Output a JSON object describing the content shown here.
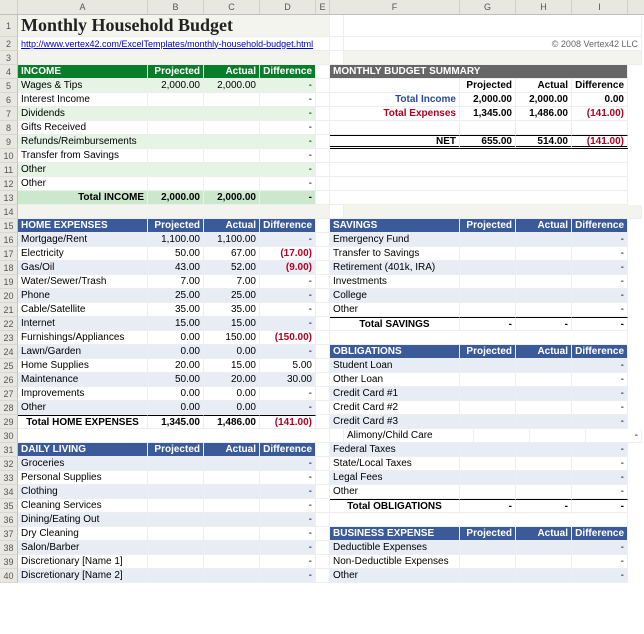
{
  "title": "Monthly Household Budget",
  "link": "http://www.vertex42.com/ExcelTemplates/monthly-household-budget.html",
  "copyright": "© 2008 Vertex42 LLC",
  "cols": [
    "",
    "A",
    "B",
    "C",
    "D",
    "E",
    "F",
    "G",
    "H",
    "I"
  ],
  "cols_w": [
    18,
    130,
    56,
    56,
    56,
    14,
    130,
    56,
    56,
    56
  ],
  "headers": {
    "proj": "Projected",
    "act": "Actual",
    "diff": "Difference"
  },
  "income": {
    "title": "INCOME",
    "rows": [
      {
        "n": "Wages & Tips",
        "p": "2,000.00",
        "a": "2,000.00",
        "d": "-"
      },
      {
        "n": "Interest Income",
        "p": "",
        "a": "",
        "d": "-"
      },
      {
        "n": "Dividends",
        "p": "",
        "a": "",
        "d": "-"
      },
      {
        "n": "Gifts Received",
        "p": "",
        "a": "",
        "d": "-"
      },
      {
        "n": "Refunds/Reimbursements",
        "p": "",
        "a": "",
        "d": "-"
      },
      {
        "n": "Transfer from Savings",
        "p": "",
        "a": "",
        "d": "-"
      },
      {
        "n": "Other",
        "p": "",
        "a": "",
        "d": "-"
      },
      {
        "n": "Other",
        "p": "",
        "a": "",
        "d": "-"
      }
    ],
    "total": {
      "n": "Total INCOME",
      "p": "2,000.00",
      "a": "2,000.00",
      "d": "-"
    }
  },
  "summary": {
    "title": "MONTHLY BUDGET SUMMARY",
    "income": {
      "n": "Total Income",
      "p": "2,000.00",
      "a": "2,000.00",
      "d": "0.00"
    },
    "expenses": {
      "n": "Total Expenses",
      "p": "1,345.00",
      "a": "1,486.00",
      "d": "(141.00)"
    },
    "net": {
      "n": "NET",
      "p": "655.00",
      "a": "514.00",
      "d": "(141.00)"
    }
  },
  "home": {
    "title": "HOME EXPENSES",
    "rows": [
      {
        "n": "Mortgage/Rent",
        "p": "1,100.00",
        "a": "1,100.00",
        "d": "-"
      },
      {
        "n": "Electricity",
        "p": "50.00",
        "a": "67.00",
        "d": "(17.00)"
      },
      {
        "n": "Gas/Oil",
        "p": "43.00",
        "a": "52.00",
        "d": "(9.00)"
      },
      {
        "n": "Water/Sewer/Trash",
        "p": "7.00",
        "a": "7.00",
        "d": "-"
      },
      {
        "n": "Phone",
        "p": "25.00",
        "a": "25.00",
        "d": "-"
      },
      {
        "n": "Cable/Satellite",
        "p": "35.00",
        "a": "35.00",
        "d": "-"
      },
      {
        "n": "Internet",
        "p": "15.00",
        "a": "15.00",
        "d": "-"
      },
      {
        "n": "Furnishings/Appliances",
        "p": "0.00",
        "a": "150.00",
        "d": "(150.00)"
      },
      {
        "n": "Lawn/Garden",
        "p": "0.00",
        "a": "0.00",
        "d": "-"
      },
      {
        "n": "Home Supplies",
        "p": "20.00",
        "a": "15.00",
        "d": "5.00"
      },
      {
        "n": "Maintenance",
        "p": "50.00",
        "a": "20.00",
        "d": "30.00"
      },
      {
        "n": "Improvements",
        "p": "0.00",
        "a": "0.00",
        "d": "-"
      },
      {
        "n": "Other",
        "p": "0.00",
        "a": "0.00",
        "d": "-"
      }
    ],
    "total": {
      "n": "Total HOME EXPENSES",
      "p": "1,345.00",
      "a": "1,486.00",
      "d": "(141.00)"
    }
  },
  "savings": {
    "title": "SAVINGS",
    "rows": [
      {
        "n": "Emergency Fund",
        "p": "",
        "a": "",
        "d": "-"
      },
      {
        "n": "Transfer to Savings",
        "p": "",
        "a": "",
        "d": "-"
      },
      {
        "n": "Retirement (401k, IRA)",
        "p": "",
        "a": "",
        "d": "-"
      },
      {
        "n": "Investments",
        "p": "",
        "a": "",
        "d": "-"
      },
      {
        "n": "College",
        "p": "",
        "a": "",
        "d": "-"
      },
      {
        "n": "Other",
        "p": "",
        "a": "",
        "d": "-"
      }
    ],
    "total": {
      "n": "Total SAVINGS",
      "p": "-",
      "a": "-",
      "d": "-"
    }
  },
  "daily": {
    "title": "DAILY LIVING",
    "rows": [
      {
        "n": "Groceries",
        "p": "",
        "a": "",
        "d": "-"
      },
      {
        "n": "Personal Supplies",
        "p": "",
        "a": "",
        "d": "-"
      },
      {
        "n": "Clothing",
        "p": "",
        "a": "",
        "d": "-"
      },
      {
        "n": "Cleaning Services",
        "p": "",
        "a": "",
        "d": "-"
      },
      {
        "n": "Dining/Eating Out",
        "p": "",
        "a": "",
        "d": "-"
      },
      {
        "n": "Dry Cleaning",
        "p": "",
        "a": "",
        "d": "-"
      },
      {
        "n": "Salon/Barber",
        "p": "",
        "a": "",
        "d": "-"
      },
      {
        "n": "Discretionary [Name 1]",
        "p": "",
        "a": "",
        "d": "-"
      },
      {
        "n": "Discretionary [Name 2]",
        "p": "",
        "a": "",
        "d": "-"
      }
    ]
  },
  "obligations": {
    "title": "OBLIGATIONS",
    "rows": [
      {
        "n": "Student Loan",
        "p": "",
        "a": "",
        "d": "-"
      },
      {
        "n": "Other Loan",
        "p": "",
        "a": "",
        "d": "-"
      },
      {
        "n": "Credit Card #1",
        "p": "",
        "a": "",
        "d": "-"
      },
      {
        "n": "Credit Card #2",
        "p": "",
        "a": "",
        "d": "-"
      },
      {
        "n": "Credit Card #3",
        "p": "",
        "a": "",
        "d": "-"
      },
      {
        "n": "Alimony/Child Care",
        "p": "",
        "a": "",
        "d": "-"
      },
      {
        "n": "Federal Taxes",
        "p": "",
        "a": "",
        "d": "-"
      },
      {
        "n": "State/Local Taxes",
        "p": "",
        "a": "",
        "d": "-"
      },
      {
        "n": "Legal Fees",
        "p": "",
        "a": "",
        "d": "-"
      },
      {
        "n": "Other",
        "p": "",
        "a": "",
        "d": "-"
      }
    ],
    "total": {
      "n": "Total OBLIGATIONS",
      "p": "-",
      "a": "-",
      "d": "-"
    }
  },
  "business": {
    "title": "BUSINESS EXPENSE",
    "rows": [
      {
        "n": "Deductible Expenses",
        "p": "",
        "a": "",
        "d": "-"
      },
      {
        "n": "Non-Deductible Expenses",
        "p": "",
        "a": "",
        "d": "-"
      },
      {
        "n": "Other",
        "p": "",
        "a": "",
        "d": "-"
      }
    ]
  }
}
